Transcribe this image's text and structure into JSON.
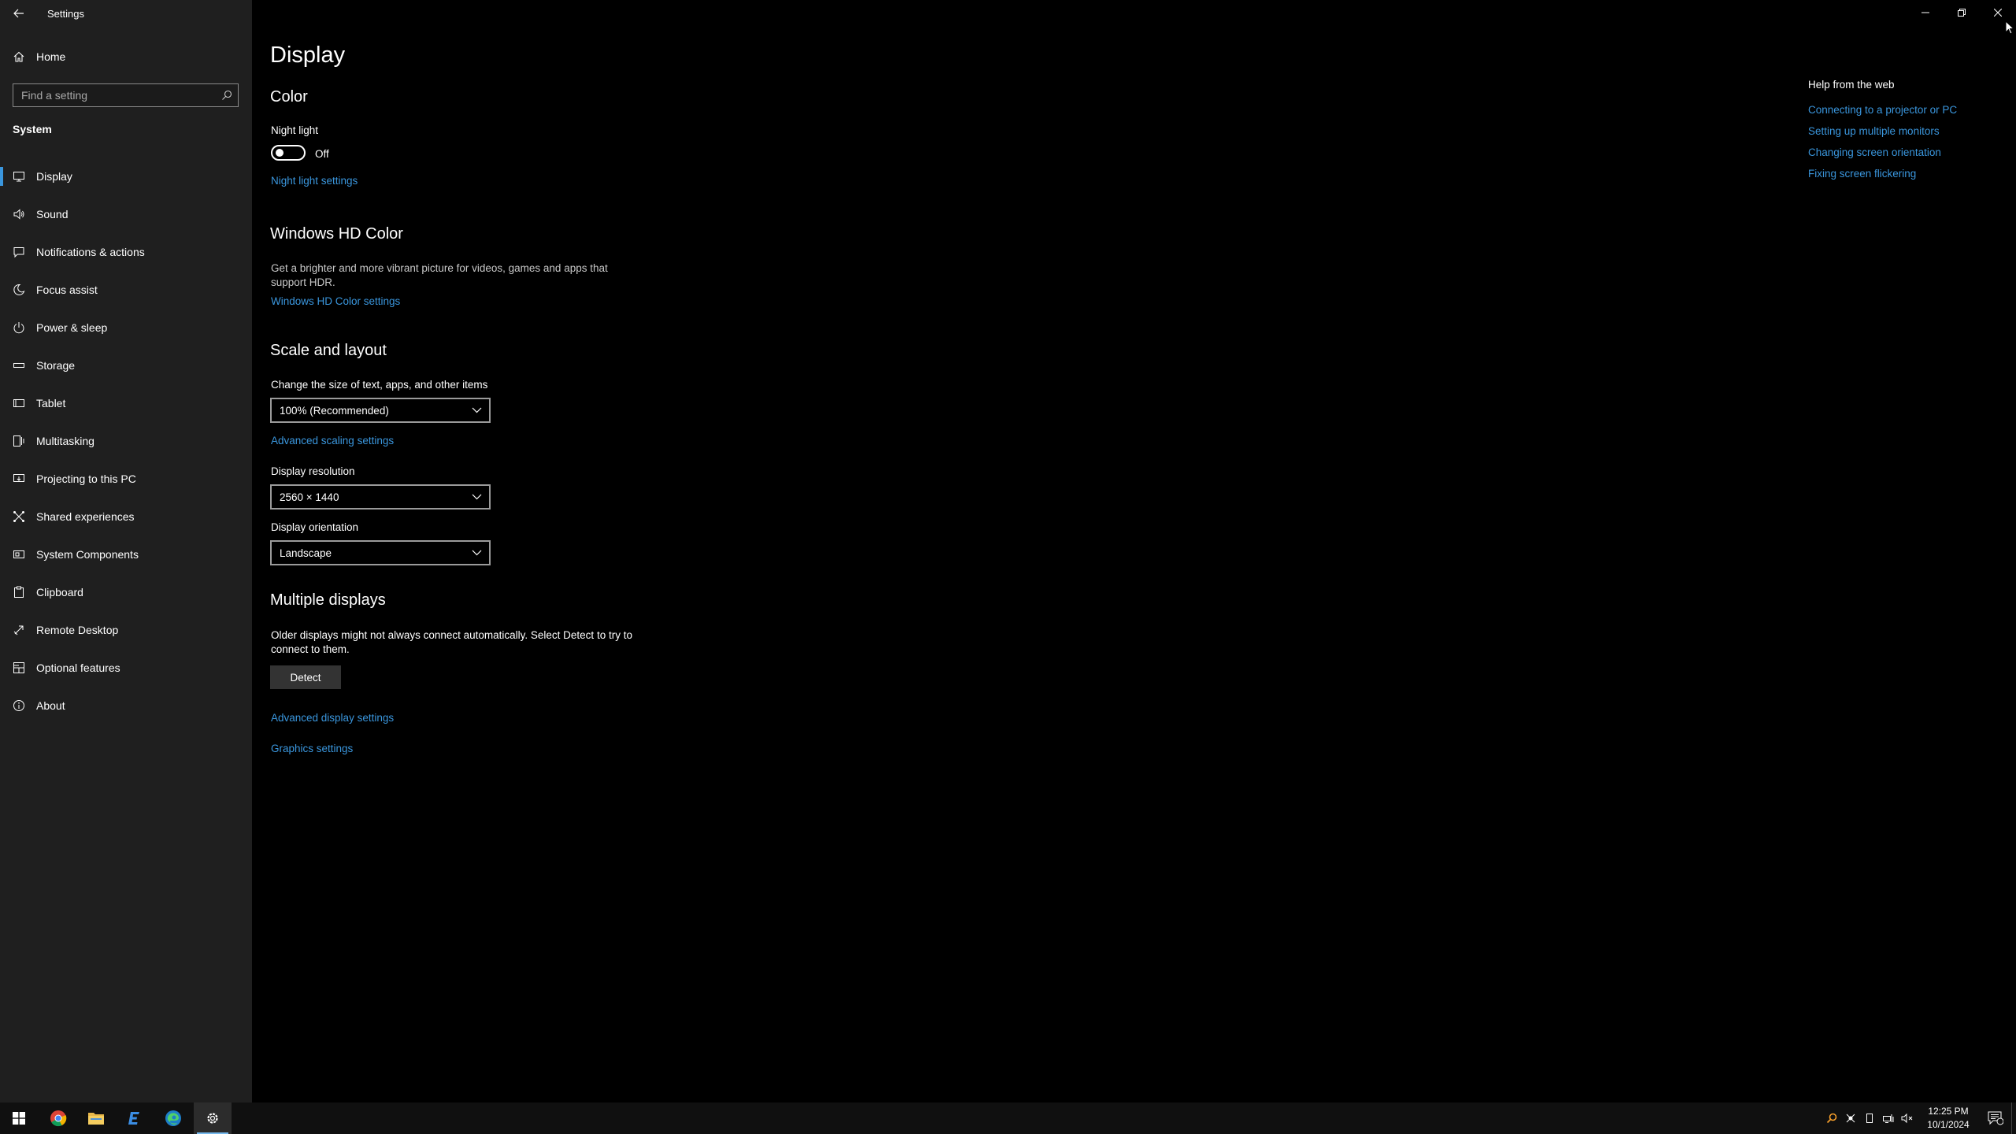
{
  "app": {
    "title": "Settings"
  },
  "sidebar": {
    "home_label": "Home",
    "search_placeholder": "Find a setting",
    "section_title": "System",
    "items": [
      {
        "label": "Display",
        "icon": "monitor-icon",
        "selected": true
      },
      {
        "label": "Sound",
        "icon": "speaker-icon"
      },
      {
        "label": "Notifications & actions",
        "icon": "notification-icon"
      },
      {
        "label": "Focus assist",
        "icon": "moon-icon"
      },
      {
        "label": "Power & sleep",
        "icon": "power-icon"
      },
      {
        "label": "Storage",
        "icon": "storage-icon"
      },
      {
        "label": "Tablet",
        "icon": "tablet-icon"
      },
      {
        "label": "Multitasking",
        "icon": "multitasking-icon"
      },
      {
        "label": "Projecting to this PC",
        "icon": "projecting-icon"
      },
      {
        "label": "Shared experiences",
        "icon": "shared-experiences-icon"
      },
      {
        "label": "System Components",
        "icon": "system-components-icon"
      },
      {
        "label": "Clipboard",
        "icon": "clipboard-icon"
      },
      {
        "label": "Remote Desktop",
        "icon": "remote-desktop-icon"
      },
      {
        "label": "Optional features",
        "icon": "optional-features-icon"
      },
      {
        "label": "About",
        "icon": "info-icon"
      }
    ]
  },
  "main": {
    "page_title": "Display",
    "color": {
      "heading": "Color",
      "night_light_label": "Night light",
      "night_light_state": "Off",
      "night_light_link": "Night light settings"
    },
    "hdr": {
      "heading": "Windows HD Color",
      "description": "Get a brighter and more vibrant picture for videos, games and apps that support HDR.",
      "link": "Windows HD Color settings"
    },
    "scale": {
      "heading": "Scale and layout",
      "size_label": "Change the size of text, apps, and other items",
      "size_value": "100% (Recommended)",
      "advanced_scaling_link": "Advanced scaling settings",
      "resolution_label": "Display resolution",
      "resolution_value": "2560 × 1440",
      "orientation_label": "Display orientation",
      "orientation_value": "Landscape"
    },
    "multiple": {
      "heading": "Multiple displays",
      "description": "Older displays might not always connect automatically. Select Detect to try to connect to them.",
      "detect_label": "Detect",
      "advanced_display_link": "Advanced display settings",
      "graphics_link": "Graphics settings"
    }
  },
  "help": {
    "title": "Help from the web",
    "links": [
      "Connecting to a projector or PC",
      "Setting up multiple monitors",
      "Changing screen orientation",
      "Fixing screen flickering"
    ]
  },
  "taskbar": {
    "apps": [
      "start-icon",
      "chrome-icon",
      "file-explorer-icon",
      "editor-icon",
      "edge-icon",
      "settings-icon"
    ],
    "time": "12:25 PM",
    "date": "10/1/2024",
    "notification_count": "2"
  },
  "colors": {
    "accent": "#3a96dd",
    "sidebar_bg": "#1f1f1f",
    "main_bg": "#000000"
  }
}
